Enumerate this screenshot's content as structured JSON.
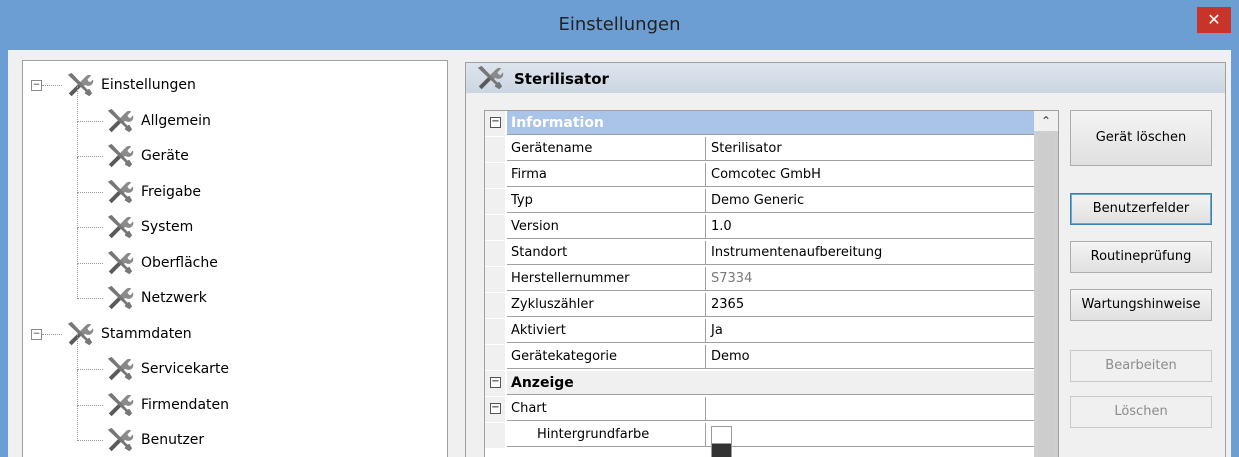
{
  "window": {
    "title": "Einstellungen",
    "close_glyph": "✕"
  },
  "tree": {
    "items": [
      {
        "label": "Einstellungen",
        "level": 0,
        "expander": "−"
      },
      {
        "label": "Allgemein",
        "level": 1
      },
      {
        "label": "Geräte",
        "level": 1
      },
      {
        "label": "Freigabe",
        "level": 1
      },
      {
        "label": "System",
        "level": 1
      },
      {
        "label": "Oberfläche",
        "level": 1
      },
      {
        "label": "Netzwerk",
        "level": 1
      },
      {
        "label": "Stammdaten",
        "level": 0,
        "expander": "−"
      },
      {
        "label": "Servicekarte",
        "level": 1
      },
      {
        "label": "Firmendaten",
        "level": 1
      },
      {
        "label": "Benutzer",
        "level": 1
      }
    ]
  },
  "panel": {
    "title": "Sterilisator"
  },
  "grid": {
    "sections": {
      "information": "Information",
      "anzeige": "Anzeige"
    },
    "properties": [
      {
        "name": "Gerätename",
        "value": "Sterilisator"
      },
      {
        "name": "Firma",
        "value": "Comcotec GmbH"
      },
      {
        "name": "Typ",
        "value": "Demo Generic"
      },
      {
        "name": "Version",
        "value": "1.0"
      },
      {
        "name": "Standort",
        "value": "Instrumentenaufbereitung"
      },
      {
        "name": "Herstellernummer",
        "value": "S7334"
      },
      {
        "name": "Zykluszähler",
        "value": "2365"
      },
      {
        "name": "Aktiviert",
        "value": "Ja"
      },
      {
        "name": "Gerätekategorie",
        "value": "Demo"
      }
    ],
    "chart_label": "Chart",
    "hintergrundfarbe_label": "Hintergrundfarbe",
    "expander_glyph": "−",
    "scroll_up_glyph": "⌃"
  },
  "buttons": {
    "geraet_loeschen": "Gerät löschen",
    "benutzerfelder": "Benutzerfelder",
    "routinepruefung": "Routineprüfung",
    "wartungshinweise": "Wartungshinweise",
    "bearbeiten": "Bearbeiten",
    "loeschen": "Löschen"
  },
  "colors": {
    "titlebar": "#6d9ed3",
    "close": "#c8342a",
    "category_header": "#a9c4e8"
  }
}
